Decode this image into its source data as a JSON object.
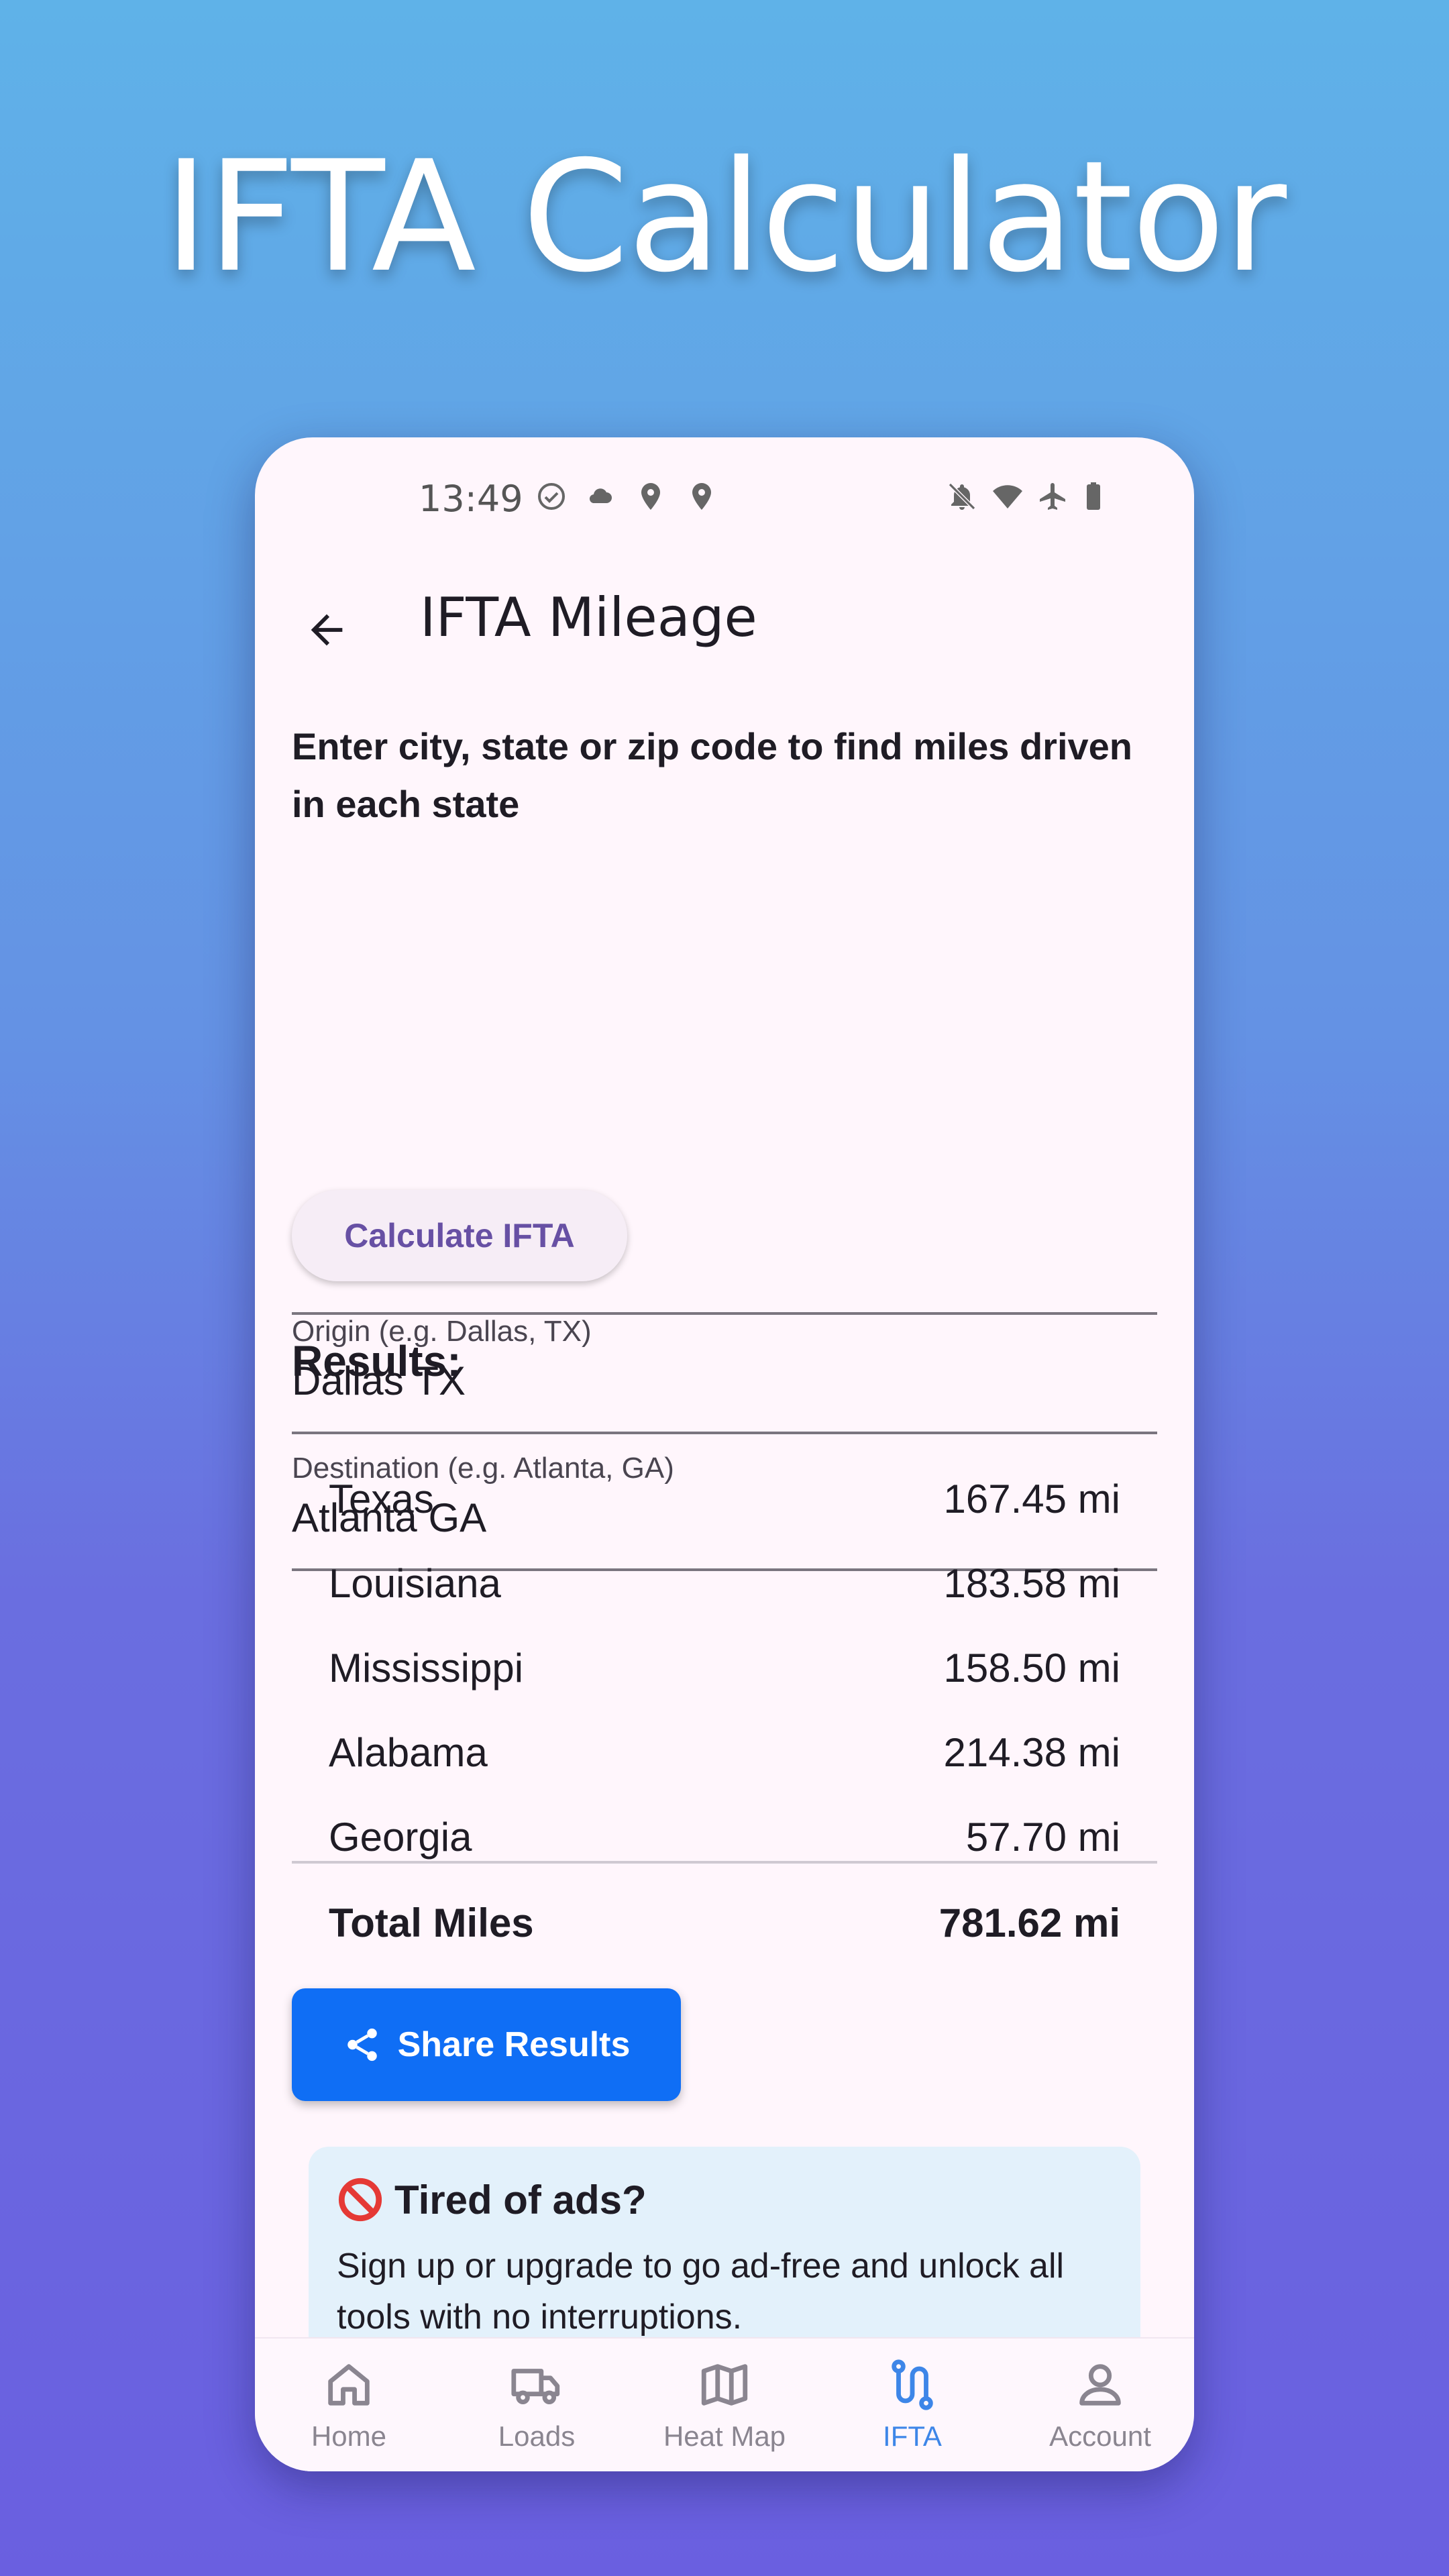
{
  "promo": {
    "title": "IFTA Calculator"
  },
  "status_bar": {
    "time": "13:49",
    "left_icons": [
      "check-circle-icon",
      "cloud-icon",
      "location-pin-icon",
      "location-pin-icon"
    ],
    "right_icons": [
      "notifications-off-icon",
      "wifi-icon",
      "airplane-icon",
      "battery-icon"
    ]
  },
  "app_bar": {
    "title": "IFTA Mileage",
    "back_icon": "back-arrow-icon"
  },
  "form": {
    "instructions": "Enter city, state or zip code to find miles driven in each state",
    "origin": {
      "label": "Origin (e.g. Dallas, TX)",
      "value": "Dallas TX"
    },
    "destination": {
      "label": "Destination (e.g. Atlanta, GA)",
      "value": "Atlanta GA"
    },
    "calculate_label": "Calculate IFTA"
  },
  "results": {
    "heading": "Results:",
    "rows": [
      {
        "state": "Texas",
        "miles": "167.45 mi"
      },
      {
        "state": "Louisiana",
        "miles": "183.58 mi"
      },
      {
        "state": "Mississippi",
        "miles": "158.50 mi"
      },
      {
        "state": "Alabama",
        "miles": "214.38 mi"
      },
      {
        "state": "Georgia",
        "miles": "57.70 mi"
      }
    ],
    "total_label": "Total Miles",
    "total_value": "781.62 mi"
  },
  "share": {
    "label": "Share Results"
  },
  "ad_card": {
    "title": "Tired of ads?",
    "body": "Sign up or upgrade to go ad-free and unlock all tools with no interruptions."
  },
  "bottom_nav": {
    "active": "IFTA",
    "items": [
      {
        "label": "Home",
        "icon": "home-icon"
      },
      {
        "label": "Loads",
        "icon": "truck-icon"
      },
      {
        "label": "Heat Map",
        "icon": "map-icon"
      },
      {
        "label": "IFTA",
        "icon": "route-icon"
      },
      {
        "label": "Account",
        "icon": "account-icon"
      }
    ]
  },
  "colors": {
    "accent_blue": "#0f6ef5",
    "active_nav": "#3d86e8",
    "button_text_purple": "#6750a4",
    "ad_card_bg": "#e3f1fb",
    "surface": "#fff6fc"
  }
}
